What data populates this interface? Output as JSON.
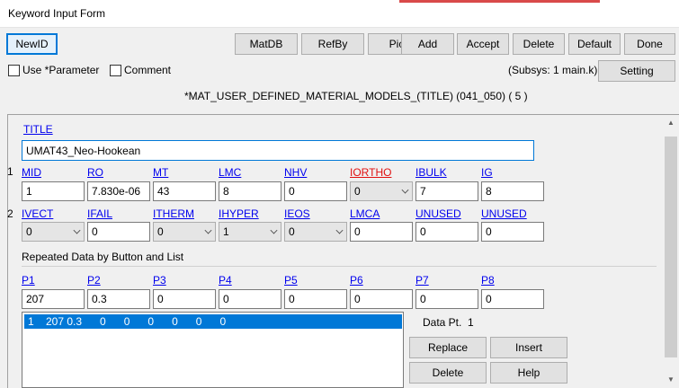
{
  "window": {
    "title": "Keyword Input Form"
  },
  "toolbar": {
    "newid": "NewID",
    "buttons": [
      "MatDB",
      "RefBy",
      "Pick",
      "Add",
      "Accept",
      "Delete",
      "Default",
      "Done"
    ]
  },
  "options": {
    "use_parameter": "Use *Parameter",
    "comment": "Comment",
    "subsys": "(Subsys: 1 main.k)",
    "setting": "Setting"
  },
  "keyword": {
    "heading": "*MAT_USER_DEFINED_MATERIAL_MODELS_(TITLE) (041_050)    ( 5 )"
  },
  "title_card": {
    "label": "TITLE",
    "value": "UMAT43_Neo-Hookean"
  },
  "card1": {
    "row_num": "1",
    "labels": [
      "MID",
      "RO",
      "MT",
      "LMC",
      "NHV",
      "IORTHO",
      "IBULK",
      "IG"
    ],
    "values": [
      "1",
      "7.830e-06",
      "43",
      "8",
      "0",
      "0",
      "7",
      "8"
    ]
  },
  "card2": {
    "row_num": "2",
    "labels": [
      "IVECT",
      "IFAIL",
      "ITHERM",
      "IHYPER",
      "IEOS",
      "LMCA",
      "UNUSED",
      "UNUSED"
    ],
    "values": [
      "0",
      "0",
      "0",
      "1",
      "0",
      "0",
      "0",
      "0"
    ]
  },
  "repeated": {
    "heading": "Repeated Data by Button and List",
    "labels": [
      "P1",
      "P2",
      "P3",
      "P4",
      "P5",
      "P6",
      "P7",
      "P8"
    ],
    "values": [
      "207",
      "0.3",
      "0",
      "0",
      "0",
      "0",
      "0",
      "0"
    ],
    "list_items": [
      "1    207 0.3      0      0      0      0      0      0"
    ],
    "data_pt_label": "Data Pt.",
    "data_pt_value": "1",
    "buttons": {
      "replace": "Replace",
      "insert": "Insert",
      "delete": "Delete",
      "help": "Help"
    }
  },
  "colors": {
    "accent": "#0078d7",
    "link": "#0000ee",
    "required_link": "#e01010"
  },
  "icons": {
    "scroll_up": "chevron-up-icon",
    "scroll_down": "chevron-down-icon",
    "dropdown": "chevron-down-icon"
  }
}
